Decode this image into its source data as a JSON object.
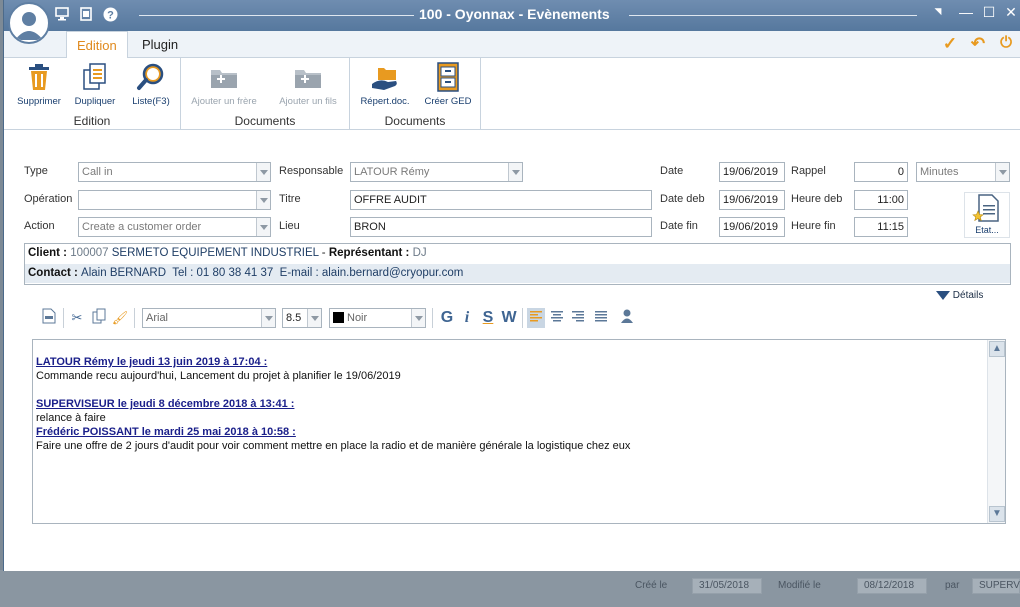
{
  "window": {
    "title": "100 - Oyonnax - Evènements",
    "minimize": "—",
    "maximize": "☐",
    "close": "✕"
  },
  "titlebar_icons": [
    "monitor-icon",
    "film-icon",
    "help-icon"
  ],
  "titlebar_help": "?",
  "ribbon": {
    "tabs": [
      {
        "label": "Edition",
        "active": true
      },
      {
        "label": "Plugin",
        "active": false
      }
    ],
    "groups": [
      {
        "label": "Edition",
        "buttons": [
          "Supprimer",
          "Dupliquer",
          "Liste(F3)"
        ]
      },
      {
        "label": "Documents",
        "buttons": [
          "Ajouter un frère",
          "Ajouter un  fils"
        ]
      },
      {
        "label": "Documents",
        "buttons": [
          "Répert.doc.",
          "Créer GED"
        ]
      }
    ]
  },
  "form": {
    "type_label": "Type",
    "type_value": "Call in",
    "operation_label": "Opération",
    "operation_value": "",
    "action_label": "Action",
    "action_value": "Create a customer order",
    "responsable_label": "Responsable",
    "responsable_value": "LATOUR Rémy",
    "titre_label": "Titre",
    "titre_value": "OFFRE AUDIT",
    "lieu_label": "Lieu",
    "lieu_value": "BRON",
    "date_label": "Date",
    "date_value": "19/06/2019",
    "date_deb_label": "Date deb",
    "date_deb_value": "19/06/2019",
    "date_fin_label": "Date fin",
    "date_fin_value": "19/06/2019",
    "rappel_label": "Rappel",
    "rappel_value": "0",
    "rappel_unit": "Minutes",
    "heure_deb_label": "Heure deb",
    "heure_deb_value": "11:00",
    "heure_fin_label": "Heure fin",
    "heure_fin_value": "11:15",
    "etat_label": "Etat..."
  },
  "client": {
    "client_label": "Client",
    "client_code": "100007",
    "client_name": "SERMETO EQUIPEMENT INDUSTRIEL",
    "rep_label": "Représentant",
    "rep_value": "DJ",
    "contact_label": "Contact",
    "contact_name": "Alain BERNARD",
    "tel_label": "Tel :",
    "tel_value": "01 80 38 41 37",
    "email_label": "E-mail :",
    "email_value": "alain.bernard@cryopur.com"
  },
  "details_label": "Détails",
  "editor_toolbar": {
    "font": "Arial",
    "size": "8.5",
    "color": "Noir",
    "bold": "G",
    "italic": "i",
    "strike": "S",
    "word": "W"
  },
  "notes": [
    {
      "header": "LATOUR Rémy le jeudi 13 juin 2019 à 17:04 :",
      "text": " Commande recu aujourd'hui, Lancement du projet à planifier le 19/06/2019"
    },
    {
      "header": "SUPERVISEUR le jeudi 8 décembre 2018 à 13:41 :",
      "text": "relance à faire"
    },
    {
      "header": "Frédéric POISSANT le mardi 25 mai 2018 à 10:58 :",
      "text": "Faire une offre de 2 jours d'audit pour voir comment mettre en place la radio et de manière générale la logistique chez eux"
    }
  ],
  "background": {
    "cree_label": "Créé le",
    "cree_value": "31/05/2018",
    "modifie_label": "Modifié le",
    "modifie_value": "08/12/2018",
    "par_label": "par",
    "par_value": "SUPERV"
  },
  "colors": {
    "accent": "#e08a1e",
    "titlebar": "#5f7fa3",
    "link": "#1a1f8a"
  }
}
